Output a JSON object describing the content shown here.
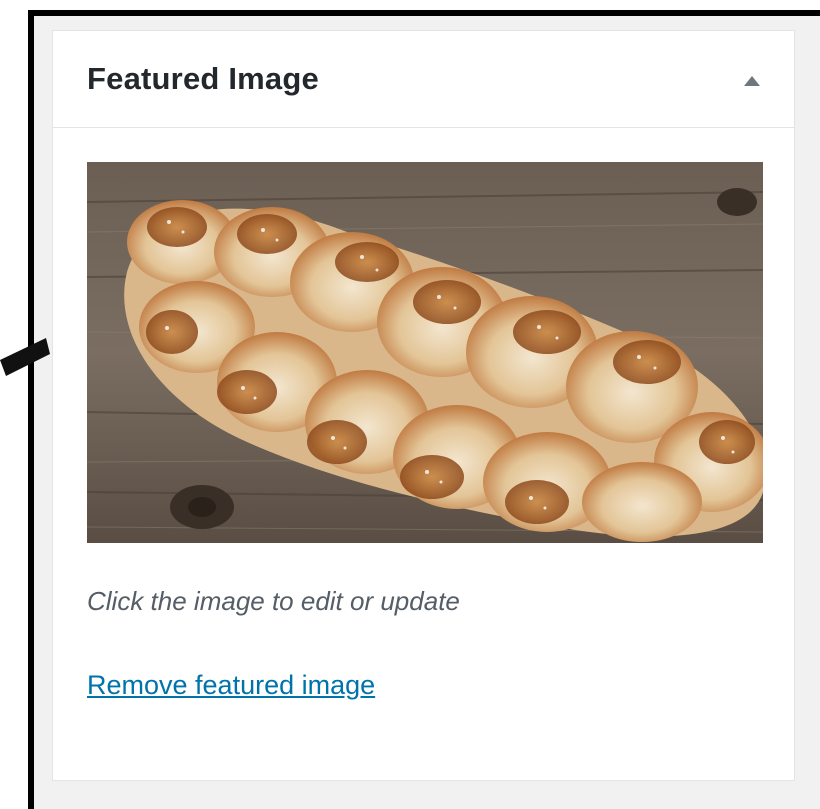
{
  "postbox": {
    "title": "Featured Image",
    "toggle_icon": "triangle-up-icon"
  },
  "featured_image": {
    "subject": "braided bread loaf on wooden boards",
    "caption_hint": "Click the image to edit or update",
    "remove_label": "Remove featured image"
  },
  "colors": {
    "link": "#0073aa",
    "title": "#23282d",
    "hint": "#555d66",
    "border": "#e2e4e7"
  }
}
